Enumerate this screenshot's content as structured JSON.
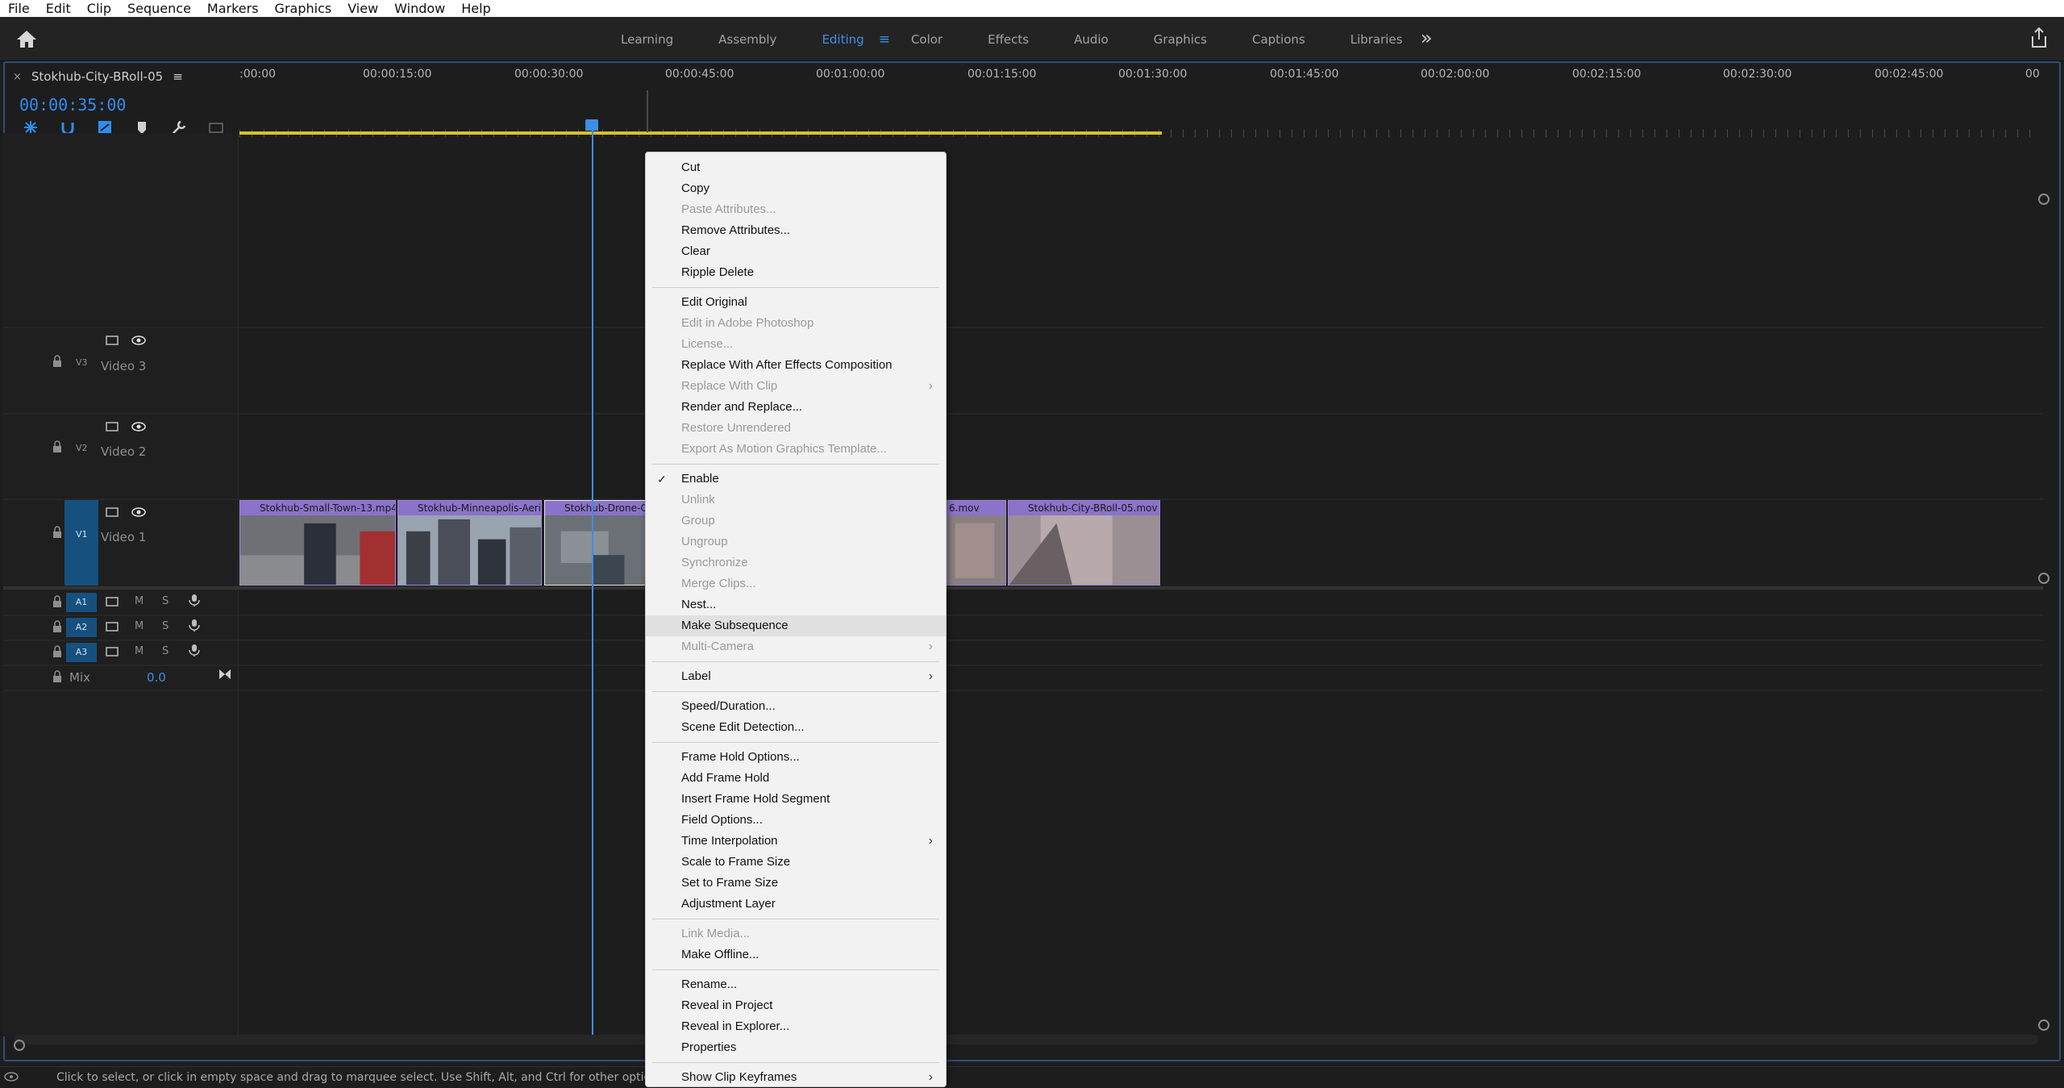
{
  "menubar": [
    "File",
    "Edit",
    "Clip",
    "Sequence",
    "Markers",
    "Graphics",
    "View",
    "Window",
    "Help"
  ],
  "workspace": {
    "tabs": [
      "Learning",
      "Assembly",
      "Editing",
      "Color",
      "Effects",
      "Audio",
      "Graphics",
      "Captions",
      "Libraries"
    ],
    "active": "Editing",
    "more_glyph": "»"
  },
  "panel": {
    "sequence_name": "Stokhub-City-BRoll-05",
    "menu_glyph": "≡",
    "close_glyph": "×",
    "timecode": "00:00:35:00"
  },
  "ruler": {
    "labels": [
      ":00:00",
      "00:00:15:00",
      "00:00:30:00",
      "00:00:45:00",
      "00:01:00:00",
      "00:01:15:00",
      "00:01:30:00",
      "00:01:45:00",
      "00:02:00:00",
      "00:02:15:00",
      "00:02:30:00",
      "00:02:45:00",
      "00"
    ]
  },
  "tracks": {
    "video": [
      {
        "id": "V3",
        "name": "Video 3"
      },
      {
        "id": "V2",
        "name": "Video 2"
      },
      {
        "id": "V1",
        "name": "Video 1"
      }
    ],
    "audio": [
      {
        "id": "A1",
        "m": "M",
        "s": "S"
      },
      {
        "id": "A2",
        "m": "M",
        "s": "S"
      },
      {
        "id": "A3",
        "m": "M",
        "s": "S"
      }
    ],
    "mix_label": "Mix",
    "mix_value": "0.0"
  },
  "clips": [
    {
      "name": "Stokhub-Small-Town-13.mp4"
    },
    {
      "name": "Stokhub-Minneapolis-Aerial"
    },
    {
      "name": "Stokhub-Drone-Ci"
    },
    {
      "name": "6.mov"
    },
    {
      "name": "Stokhub-City-BRoll-05.mov"
    }
  ],
  "context_menu": {
    "items": [
      {
        "label": "Cut",
        "enabled": true
      },
      {
        "label": "Copy",
        "enabled": true
      },
      {
        "label": "Paste Attributes...",
        "enabled": false
      },
      {
        "label": "Remove Attributes...",
        "enabled": true
      },
      {
        "label": "Clear",
        "enabled": true
      },
      {
        "label": "Ripple Delete",
        "enabled": true
      },
      {
        "sep": true
      },
      {
        "label": "Edit Original",
        "enabled": true
      },
      {
        "label": "Edit in Adobe Photoshop",
        "enabled": false
      },
      {
        "label": "License...",
        "enabled": false
      },
      {
        "label": "Replace With After Effects Composition",
        "enabled": true
      },
      {
        "label": "Replace With Clip",
        "enabled": false,
        "submenu": true
      },
      {
        "label": "Render and Replace...",
        "enabled": true
      },
      {
        "label": "Restore Unrendered",
        "enabled": false
      },
      {
        "label": "Export As Motion Graphics Template...",
        "enabled": false
      },
      {
        "sep": true
      },
      {
        "label": "Enable",
        "enabled": true,
        "checked": true
      },
      {
        "label": "Unlink",
        "enabled": false
      },
      {
        "label": "Group",
        "enabled": false
      },
      {
        "label": "Ungroup",
        "enabled": false
      },
      {
        "label": "Synchronize",
        "enabled": false
      },
      {
        "label": "Merge Clips...",
        "enabled": false
      },
      {
        "label": "Nest...",
        "enabled": true
      },
      {
        "label": "Make Subsequence",
        "enabled": true,
        "highlight": true
      },
      {
        "label": "Multi-Camera",
        "enabled": false,
        "submenu": true
      },
      {
        "sep": true
      },
      {
        "label": "Label",
        "enabled": true,
        "submenu": true
      },
      {
        "sep": true
      },
      {
        "label": "Speed/Duration...",
        "enabled": true
      },
      {
        "label": "Scene Edit Detection...",
        "enabled": true
      },
      {
        "sep": true
      },
      {
        "label": "Frame Hold Options...",
        "enabled": true
      },
      {
        "label": "Add Frame Hold",
        "enabled": true
      },
      {
        "label": "Insert Frame Hold Segment",
        "enabled": true
      },
      {
        "label": "Field Options...",
        "enabled": true
      },
      {
        "label": "Time Interpolation",
        "enabled": true,
        "submenu": true
      },
      {
        "label": "Scale to Frame Size",
        "enabled": true
      },
      {
        "label": "Set to Frame Size",
        "enabled": true
      },
      {
        "label": "Adjustment Layer",
        "enabled": true
      },
      {
        "sep": true
      },
      {
        "label": "Link Media...",
        "enabled": false
      },
      {
        "label": "Make Offline...",
        "enabled": true
      },
      {
        "sep": true
      },
      {
        "label": "Rename...",
        "enabled": true
      },
      {
        "label": "Reveal in Project",
        "enabled": true
      },
      {
        "label": "Reveal in Explorer...",
        "enabled": true
      },
      {
        "label": "Properties",
        "enabled": true
      },
      {
        "sep": true
      },
      {
        "label": "Show Clip Keyframes",
        "enabled": true,
        "submenu": true
      }
    ],
    "check_glyph": "✓",
    "arrow_glyph": "›"
  },
  "status": {
    "text": "Click to select, or click in empty space and drag to marquee select. Use Shift, Alt, and Ctrl for other options."
  },
  "colors": {
    "accent": "#3d8ee6",
    "track_target": "#16507f",
    "clip": "#7b66b6",
    "work_area": "#d9c12a"
  }
}
